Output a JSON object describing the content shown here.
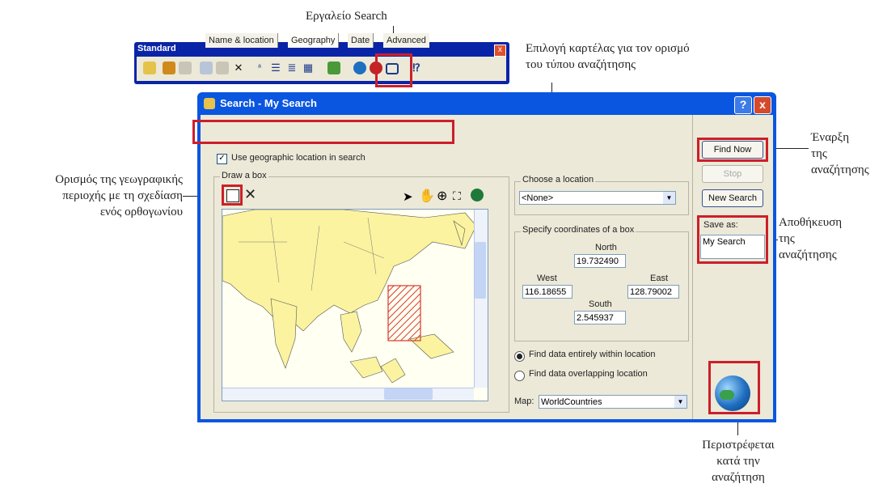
{
  "annotations": {
    "search_tool": "Εργαλείο Search",
    "tab_select": "Επιλογή καρτέλας για τον ορισμό\nτου τύπου αναζήτησης",
    "start_search": "Έναρξη\nτης\nαναζήτησης",
    "draw_area": "Ορισμός της γεωγραφικής\nπεριοχής με τη σχεδίαση\nενός ορθογωνίου",
    "save_search": "Αποθήκευση\nτης\nαναζήτησης",
    "rotates": "Περιστρέφεται\nκατά την\nαναζήτηση"
  },
  "toolbar": {
    "title": "Standard",
    "close": "x"
  },
  "window": {
    "title": "Search - My Search",
    "help": "?",
    "close": "x",
    "tabs": [
      "Name & location",
      "Geography",
      "Date",
      "Advanced"
    ],
    "use_geo_label": "Use geographic location in search",
    "draw_box_label": "Draw a box",
    "choose_location_label": "Choose a location",
    "location_value": "<None>",
    "coords_label": "Specify coordinates of a box",
    "north_label": "North",
    "north_value": "19.732490",
    "west_label": "West",
    "west_value": "116.18655",
    "east_label": "East",
    "east_value": "128.79002",
    "south_label": "South",
    "south_value": "2.545937",
    "radio_within": "Find data entirely within location",
    "radio_overlap": "Find data overlapping location",
    "map_label": "Map:",
    "map_value": "WorldCountries",
    "find_now": "Find Now",
    "stop": "Stop",
    "new_search": "New Search",
    "save_as_label": "Save as:",
    "save_as_value": "My Search"
  },
  "colors": {
    "highlight": "#cc1f2a",
    "titlebar": "#0a56e0",
    "land": "#fbf3a0",
    "sea": "#fffff2"
  }
}
